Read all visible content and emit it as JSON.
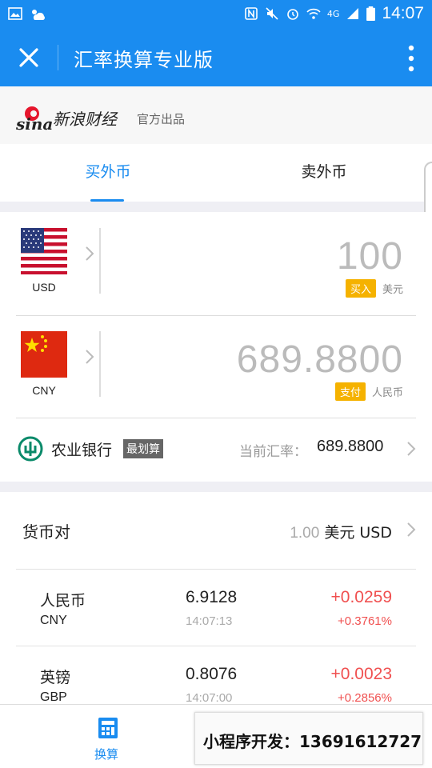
{
  "status_bar": {
    "time": "14:07",
    "network": "4G"
  },
  "header": {
    "title": "汇率换算专业版",
    "close_icon": "close-icon",
    "more_icon": "more-vertical-icon"
  },
  "brand": {
    "logo_text": "新浪财经",
    "official": "官方出品"
  },
  "tabs": [
    {
      "label": "买外币",
      "active": true
    },
    {
      "label": "卖外币",
      "active": false
    }
  ],
  "converter": {
    "from": {
      "code": "USD",
      "amount": "100",
      "tag": "买入",
      "unit": "美元"
    },
    "to": {
      "code": "CNY",
      "amount": "689.8800",
      "tag": "支付",
      "unit": "人民币"
    }
  },
  "bank": {
    "name": "农业银行",
    "badge": "最划算",
    "rate_label": "当前汇率：",
    "rate_value": "689.8800"
  },
  "pairs": {
    "title": "货币对",
    "base_amount": "1.00",
    "base_unit": "美元 USD",
    "items": [
      {
        "name": "人民币",
        "code": "CNY",
        "price": "6.9128",
        "time": "14:07:13",
        "change": "+0.0259",
        "pct": "+0.3761%"
      },
      {
        "name": "英镑",
        "code": "GBP",
        "price": "0.8076",
        "time": "14:07:00",
        "change": "+0.0023",
        "pct": "+0.2856%"
      }
    ]
  },
  "bottom_nav": {
    "label": "换算"
  },
  "promo": {
    "text": "小程序开发：13691612727"
  },
  "colors": {
    "primary": "#1a8cf0",
    "tag": "#f5b200",
    "positive": "#f05050"
  }
}
